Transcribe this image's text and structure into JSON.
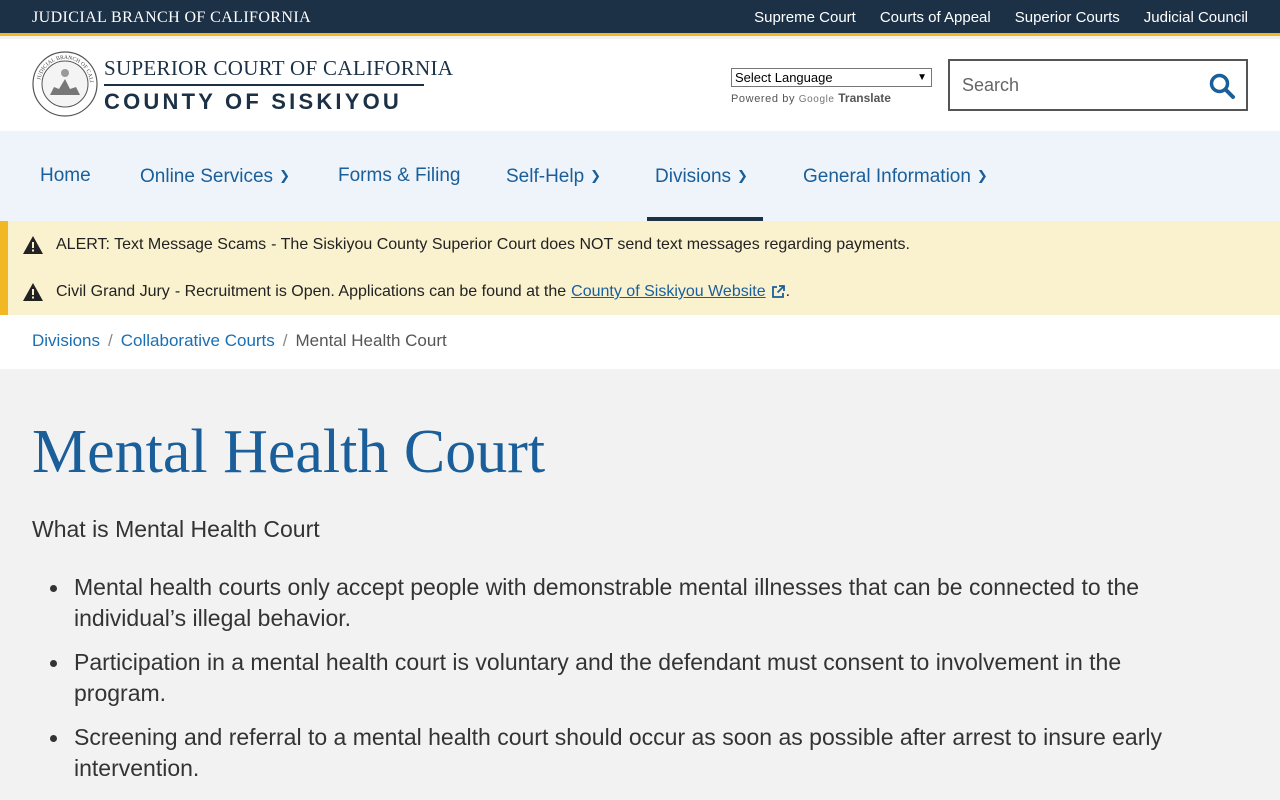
{
  "topbar": {
    "brand": "JUDICIAL BRANCH OF CALIFORNIA",
    "links": [
      "Supreme Court",
      "Courts of Appeal",
      "Superior Courts",
      "Judicial Council"
    ]
  },
  "header": {
    "court_line1": "SUPERIOR COURT OF CALIFORNIA",
    "court_line2": "COUNTY OF SISKIYOU",
    "seal_text": "JUDICIAL BRANCH OF CALIFORNIA",
    "language_select": "Select Language",
    "powered_by": "Powered by",
    "google_label": "Google",
    "translate_label": "Translate",
    "search_placeholder": "Search"
  },
  "nav": {
    "items": [
      {
        "label": "Home"
      },
      {
        "label": "Online Services"
      },
      {
        "label": "Forms & Filing"
      },
      {
        "label": "Self-Help"
      },
      {
        "label": "Divisions"
      },
      {
        "label": "General Information"
      }
    ],
    "active": "Divisions"
  },
  "alerts": [
    {
      "title": "ALERT: Text Message Scams",
      "text": "- The Siskiyou County Superior Court does NOT send text messages regarding payments."
    },
    {
      "title": "Civil Grand Jury",
      "text": "- Recruitment is Open.  Applications can be found at the",
      "link": "County of Siskiyou Website",
      "tail": "."
    }
  ],
  "breadcrumb": {
    "items": [
      "Divisions",
      "Collaborative Courts"
    ],
    "current": "Mental Health Court",
    "separator": "/"
  },
  "main": {
    "title": "Mental Health Court",
    "subhead": "What is Mental Health Court",
    "bullets": [
      "Mental health courts only accept people with demonstrable mental illnesses that can be connected to the individual’s illegal behavior.",
      "Participation in a mental health court is voluntary and the defendant must consent to involvement in the program.",
      "Screening and referral to a mental health court should occur as soon as possible after arrest to insure early intervention."
    ]
  },
  "colors": {
    "navy": "#1d3146",
    "gold": "#f2b823",
    "link_blue": "#1a5e9a",
    "alert_bg": "#faf2cf",
    "nav_bg": "#eef4fa"
  }
}
